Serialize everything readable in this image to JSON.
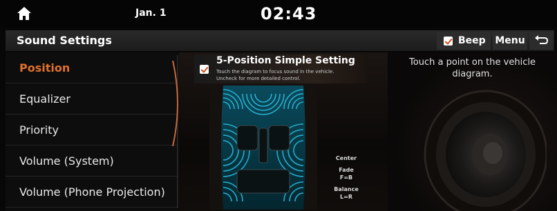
{
  "status": {
    "date": "Jan. 1",
    "time": "02:43"
  },
  "header": {
    "title": "Sound Settings",
    "beep_label": "Beep",
    "beep_checked": true,
    "menu_label": "Menu"
  },
  "sidebar": {
    "items": [
      {
        "label": "Position",
        "active": true
      },
      {
        "label": "Equalizer",
        "active": false
      },
      {
        "label": "Priority",
        "active": false
      },
      {
        "label": "Volume (System)",
        "active": false
      },
      {
        "label": "Volume (Phone Projection)",
        "active": false
      }
    ]
  },
  "position": {
    "simple_setting_title": "5-Position Simple Setting",
    "simple_setting_desc_1": "Touch the diagram to focus sound in the vehicle.",
    "simple_setting_desc_2": "Uncheck for more detailed control.",
    "simple_setting_checked": true,
    "center_label": "Center",
    "fade_label": "Fade",
    "fade_value": "F=B",
    "balance_label": "Balance",
    "balance_value": "L=R",
    "hint_line_1": "Touch a point on the vehicle",
    "hint_line_2": "diagram."
  },
  "colors": {
    "accent": "#e0712c",
    "checkbox_mark": "#d04a1a",
    "sound_wave": "#1fb5d6"
  },
  "icons": [
    "home-icon",
    "checkbox-icon",
    "back-icon",
    "speaker-icon",
    "car-diagram-icon"
  ]
}
